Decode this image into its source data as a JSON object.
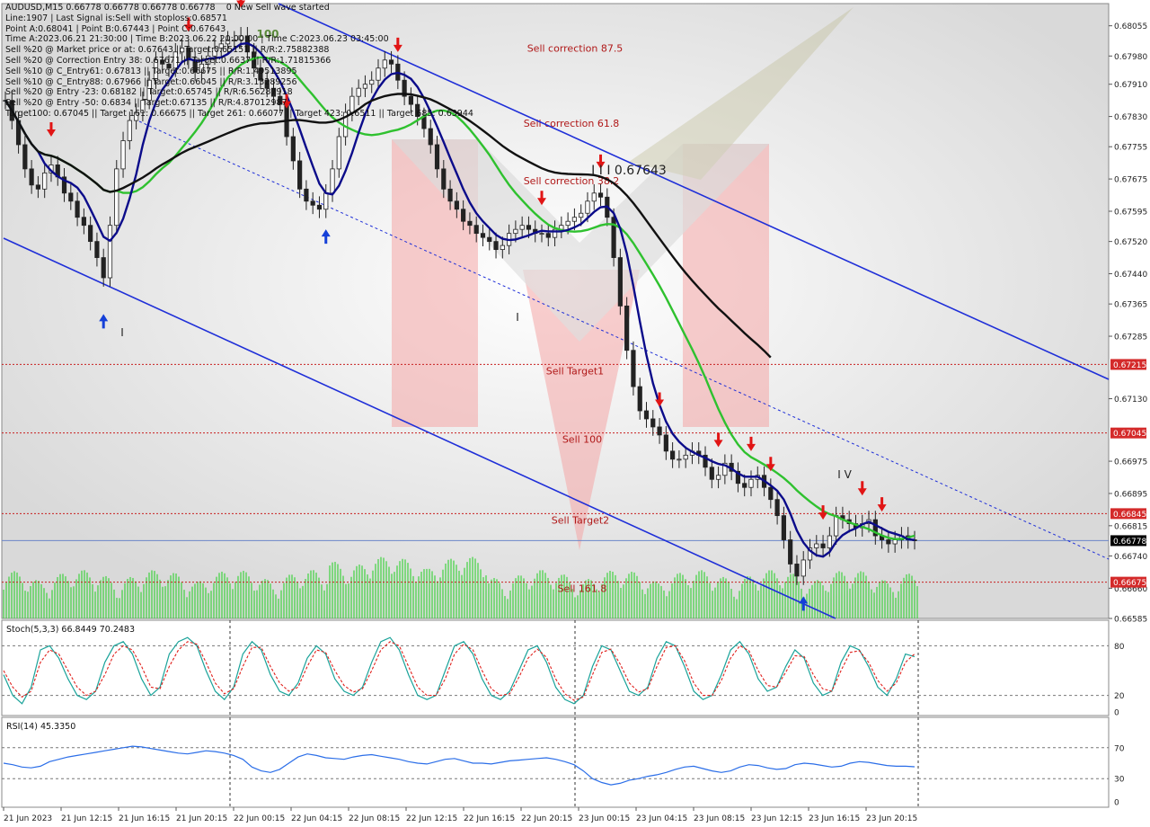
{
  "chart_data": [
    {
      "type": "line",
      "name": "price-panel",
      "symbol_header": "AUDUSD,M15  0.66778 0.66778 0.66778 0.66778",
      "status": "0 New Sell wave started",
      "info_lines": [
        "Line:1907 | Last Signal is:Sell with stoploss:0.68571",
        "Point A:0.68041 | Point B:0.67443 | Point C:0.67643",
        "Time A:2023.06.21 21:30:00 | Time B:2023.06.22 20:00:00 | Time C:2023.06.23 03:45:00",
        "Sell %20 @ Market price or at: 0.67643 || Target:0.65151 || R/R:2.75882388",
        "Sell %20 @ Correction Entry 38: 0.67671 || Target:0.6637 || R/R:1.71815366",
        "Sell %10 @ C_Entry61: 0.67813 || Target:0.66675 || R/R:1.49513895",
        "Sell %10 @ C_Entry88: 0.67966 || Target:0.66045 || R/R:3.13289256",
        "Sell %20 @ Entry -23: 0.68182 || Target:0.65745 || R/R:6.56287918",
        "Sell %20 @ Entry -50: 0.6834 || Target:0.67135 || R/R:4.87012987",
        "Target100: 0.67045 || Target 161: 0.66675 || Target 261: 0.66077 || Target 423: 0.6511 || Target 685: 0.63944"
      ],
      "y_ticks": [
        "0.68055",
        "0.67980",
        "0.67910",
        "0.67830",
        "0.67755",
        "0.67675",
        "0.67595",
        "0.67520",
        "0.67440",
        "0.67365",
        "0.67285",
        "0.67130",
        "0.66975",
        "0.66895",
        "0.66815",
        "0.66740",
        "0.66660",
        "0.66585"
      ],
      "ylim": [
        0.66585,
        0.6811
      ],
      "x_ticks": [
        "21 Jun 2023",
        "21 Jun 12:15",
        "21 Jun 16:15",
        "21 Jun 20:15",
        "22 Jun 00:15",
        "22 Jun 04:15",
        "22 Jun 08:15",
        "22 Jun 12:15",
        "22 Jun 16:15",
        "22 Jun 20:15",
        "23 Jun 00:15",
        "23 Jun 04:15",
        "23 Jun 08:15",
        "23 Jun 12:15",
        "23 Jun 16:15",
        "23 Jun 20:15"
      ],
      "price_labels": [
        {
          "text": "0.67215",
          "value": 0.67215,
          "color": "#d42a2a"
        },
        {
          "text": "0.67045",
          "value": 0.67045,
          "color": "#d42a2a"
        },
        {
          "text": "0.66845",
          "value": 0.66845,
          "color": "#d42a2a"
        },
        {
          "text": "0.66778",
          "value": 0.66778,
          "color": "#000000"
        },
        {
          "text": "0.66675",
          "value": 0.66675,
          "color": "#d42a2a"
        }
      ],
      "levels": [
        {
          "label": "Sell correction 87.5",
          "value": 0.68
        },
        {
          "label": "Sell correction 61.8",
          "value": 0.67813
        },
        {
          "label": "Sell correction 38.2",
          "value": 0.67671
        },
        {
          "label": "Sell Target1",
          "value": 0.67215
        },
        {
          "label": "Sell 100",
          "value": 0.67045
        },
        {
          "label": "Sell Target2",
          "value": 0.66845
        },
        {
          "label": "Sell 161.8",
          "value": 0.66675
        }
      ],
      "annotations": [
        "100",
        "I I I 0.67643",
        "I",
        "I",
        "I V"
      ],
      "close_series": [
        0.6787,
        0.6782,
        0.6776,
        0.677,
        0.6766,
        0.6765,
        0.6769,
        0.6771,
        0.6768,
        0.6764,
        0.6762,
        0.6758,
        0.6756,
        0.6752,
        0.6748,
        0.6743,
        0.6756,
        0.677,
        0.6777,
        0.6782,
        0.6784,
        0.6787,
        0.6792,
        0.6797,
        0.6796,
        0.6795,
        0.6799,
        0.68,
        0.6797,
        0.6794,
        0.6796,
        0.6798,
        0.68,
        0.6801,
        0.6802,
        0.6802,
        0.6803,
        0.6799,
        0.6795,
        0.6792,
        0.679,
        0.6788,
        0.6786,
        0.6778,
        0.6772,
        0.6765,
        0.6762,
        0.6761,
        0.676,
        0.6764,
        0.677,
        0.6778,
        0.6784,
        0.6788,
        0.679,
        0.6791,
        0.6792,
        0.6795,
        0.6797,
        0.6796,
        0.6792,
        0.6788,
        0.6786,
        0.6783,
        0.678,
        0.6776,
        0.677,
        0.6765,
        0.6762,
        0.676,
        0.6757,
        0.6756,
        0.6754,
        0.6753,
        0.6752,
        0.675,
        0.6751,
        0.6754,
        0.6755,
        0.6756,
        0.6755,
        0.6754,
        0.6754,
        0.6753,
        0.6755,
        0.6756,
        0.6757,
        0.6758,
        0.6759,
        0.6762,
        0.6764,
        0.6763,
        0.6758,
        0.6748,
        0.6736,
        0.6725,
        0.6716,
        0.671,
        0.6708,
        0.6706,
        0.6704,
        0.67,
        0.6698,
        0.6698,
        0.6699,
        0.67,
        0.6699,
        0.6696,
        0.6693,
        0.6694,
        0.6697,
        0.6695,
        0.6692,
        0.6691,
        0.6693,
        0.6694,
        0.6691,
        0.6688,
        0.6684,
        0.6678,
        0.6672,
        0.6669,
        0.6673,
        0.6676,
        0.6677,
        0.6676,
        0.6679,
        0.6684,
        0.6683,
        0.6682,
        0.6681,
        0.6682,
        0.6683,
        0.6679,
        0.6678,
        0.6677,
        0.6678,
        0.6679,
        0.6678,
        0.66778
      ],
      "volume_note": "tick volume histogram",
      "trendlines": "descending channel (blue), parallel dotted midline"
    },
    {
      "type": "line",
      "name": "stochastic-panel",
      "title": "Stoch(5,3,3) 66.8449 70.2483",
      "y_ticks": [
        "80",
        "20",
        "0"
      ],
      "ylim": [
        0,
        100
      ],
      "main_series": [
        45,
        20,
        10,
        30,
        75,
        80,
        65,
        40,
        20,
        15,
        25,
        60,
        80,
        85,
        70,
        40,
        20,
        30,
        70,
        85,
        90,
        80,
        50,
        25,
        15,
        30,
        70,
        85,
        75,
        45,
        25,
        20,
        35,
        65,
        80,
        70,
        40,
        25,
        20,
        30,
        60,
        85,
        90,
        75,
        45,
        20,
        15,
        20,
        50,
        80,
        85,
        70,
        40,
        20,
        15,
        25,
        50,
        75,
        80,
        60,
        30,
        15,
        10,
        20,
        55,
        80,
        75,
        50,
        25,
        20,
        30,
        65,
        85,
        80,
        55,
        25,
        15,
        20,
        45,
        75,
        85,
        70,
        40,
        25,
        30,
        55,
        75,
        65,
        35,
        20,
        25,
        60,
        80,
        75,
        55,
        30,
        20,
        40,
        70,
        66.8
      ],
      "signal_series": [
        50,
        30,
        18,
        25,
        60,
        75,
        70,
        50,
        30,
        20,
        25,
        45,
        70,
        80,
        75,
        55,
        30,
        28,
        55,
        75,
        85,
        82,
        60,
        35,
        22,
        28,
        55,
        78,
        78,
        55,
        35,
        25,
        30,
        55,
        75,
        72,
        50,
        32,
        24,
        28,
        50,
        75,
        85,
        80,
        55,
        30,
        20,
        20,
        40,
        70,
        82,
        75,
        50,
        28,
        20,
        22,
        42,
        65,
        76,
        66,
        40,
        22,
        14,
        18,
        45,
        72,
        76,
        58,
        35,
        24,
        28,
        55,
        78,
        80,
        62,
        35,
        20,
        20,
        38,
        65,
        80,
        74,
        50,
        32,
        30,
        48,
        68,
        67,
        45,
        28,
        25,
        50,
        72,
        74,
        60,
        38,
        25,
        35,
        60,
        70.2
      ]
    },
    {
      "type": "line",
      "name": "rsi-panel",
      "title": "RSI(14) 45.3350",
      "y_ticks": [
        "70",
        "30",
        "0"
      ],
      "ylim": [
        0,
        100
      ],
      "series": [
        50,
        48,
        45,
        44,
        46,
        52,
        55,
        58,
        60,
        62,
        64,
        66,
        68,
        70,
        72,
        71,
        69,
        67,
        65,
        63,
        62,
        64,
        66,
        65,
        63,
        60,
        55,
        45,
        40,
        38,
        42,
        50,
        58,
        62,
        60,
        57,
        56,
        55,
        58,
        60,
        61,
        59,
        57,
        55,
        52,
        50,
        49,
        52,
        55,
        56,
        53,
        50,
        50,
        49,
        51,
        53,
        54,
        55,
        56,
        57,
        55,
        52,
        48,
        40,
        30,
        25,
        22,
        24,
        28,
        30,
        33,
        35,
        38,
        42,
        45,
        46,
        43,
        40,
        38,
        40,
        45,
        48,
        47,
        44,
        42,
        43,
        48,
        50,
        49,
        47,
        45,
        46,
        50,
        52,
        51,
        49,
        47,
        46,
        46,
        45.3
      ]
    }
  ],
  "colors": {
    "price_grid_bg": "#ffffff",
    "candle": "#222222",
    "green_ma": "#2fc12f",
    "blue_ma": "#0b0b8a",
    "black_ma": "#111111",
    "channel": "#1f2fd8",
    "level_red": "#c82020",
    "volume": "#3fd23f",
    "stoch_main": "#1aa39a",
    "stoch_signal": "#e0201c",
    "rsi": "#2b6ee8",
    "sell_arrow": "#e11515",
    "buy_arrow": "#1540d8"
  }
}
